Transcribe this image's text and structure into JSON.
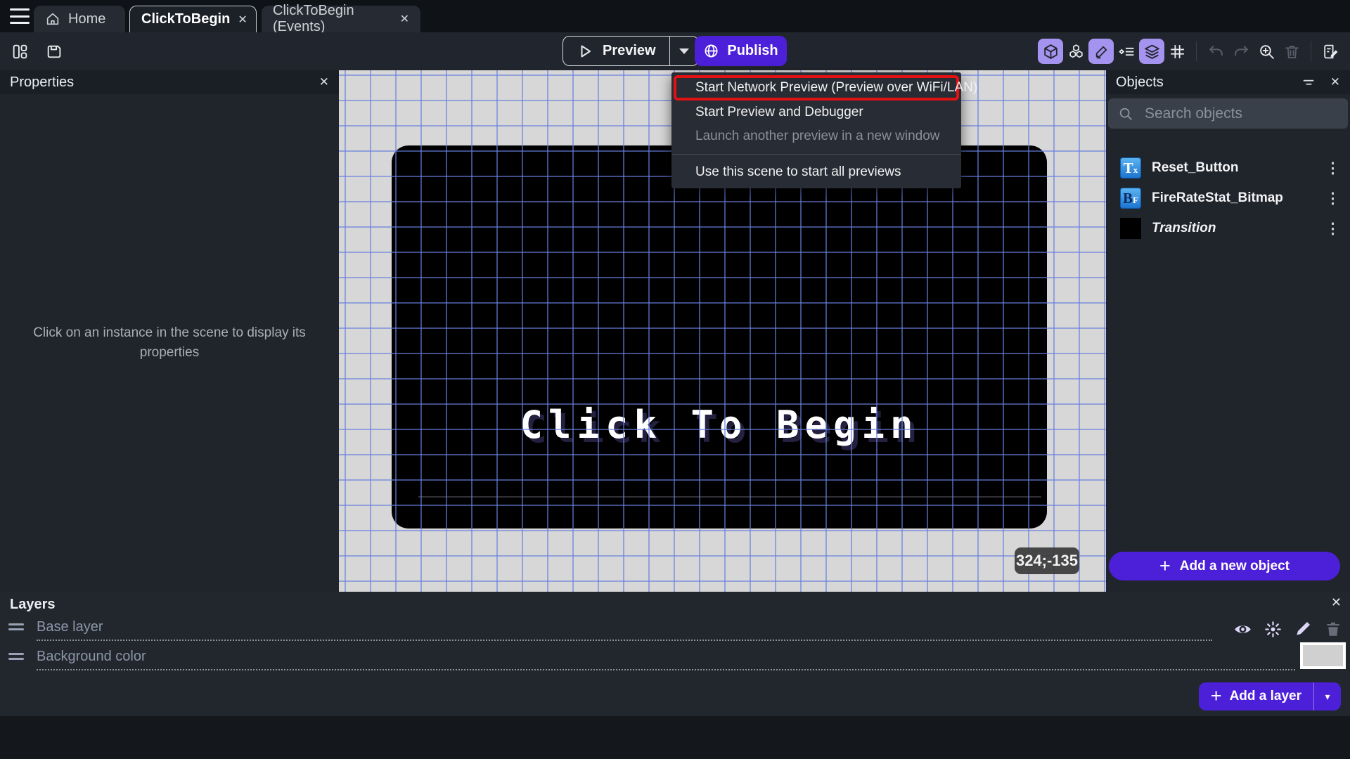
{
  "tab_bar": {
    "tabs": [
      {
        "label": "Home"
      },
      {
        "label": "ClickToBegin"
      },
      {
        "label": "ClickToBegin (Events)"
      }
    ]
  },
  "toolbar": {
    "preview_label": "Preview",
    "publish_label": "Publish"
  },
  "preview_menu": {
    "items": [
      {
        "label": "Start Network Preview (Preview over WiFi/LAN)",
        "highlighted": true
      },
      {
        "label": "Start Preview and Debugger"
      },
      {
        "label": "Launch another preview in a new window",
        "disabled": true
      },
      {
        "label": "Use this scene to start all previews"
      }
    ]
  },
  "properties_panel": {
    "title": "Properties",
    "empty_message": "Click on an instance in the scene to display its properties"
  },
  "scene_canvas": {
    "game_title_text": "Click To Begin",
    "cursor_coordinates": "324;-135"
  },
  "objects_panel": {
    "title": "Objects",
    "search_placeholder": "Search objects",
    "objects": [
      {
        "name": "Reset_Button",
        "icon_label": "Tx",
        "icon_type": "text-object-icon"
      },
      {
        "name": "FireRateStat_Bitmap",
        "icon_label": "BF",
        "icon_type": "bitmap-font-object-icon"
      },
      {
        "name": "Transition",
        "icon_label": "",
        "icon_type": "black-square-thumbnail"
      }
    ],
    "add_button_label": "Add a new object"
  },
  "layers_panel": {
    "title": "Layers",
    "layers": [
      {
        "name": "Base layer"
      },
      {
        "name": "Background color"
      }
    ],
    "add_button_label": "Add a layer"
  },
  "icons": {
    "kebab": "⋮",
    "close": "✕",
    "plus": "+",
    "caret_down": "▾"
  },
  "colors": {
    "accent_purple": "#4c1fd9",
    "active_toggle_purple": "#a494ef",
    "highlight_red": "#e31212",
    "canvas_background": "#d7d7d7",
    "grid_blue": "#687ede",
    "object_icon_blue": "#1b72cf"
  }
}
